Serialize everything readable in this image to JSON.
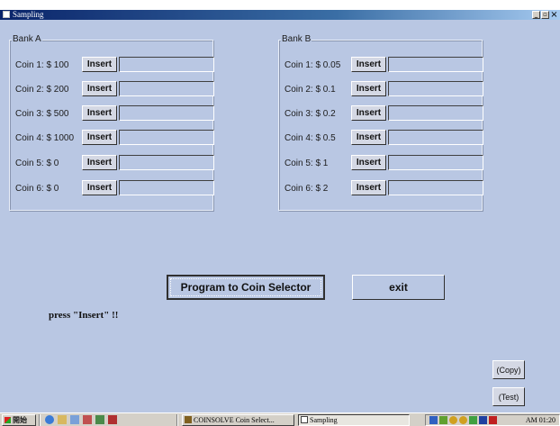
{
  "window": {
    "title": "Sampling",
    "controls": [
      "minimize-icon",
      "maximize-icon",
      "close-icon"
    ],
    "close_glyph": "×"
  },
  "bank_a": {
    "title": "Bank A",
    "coins": [
      {
        "label": "Coin 1: $ 100",
        "button": "Insert"
      },
      {
        "label": "Coin 2: $ 200",
        "button": "Insert"
      },
      {
        "label": "Coin 3: $ 500",
        "button": "Insert"
      },
      {
        "label": "Coin 4: $ 1000",
        "button": "Insert"
      },
      {
        "label": "Coin 5: $ 0",
        "button": "Insert"
      },
      {
        "label": "Coin 6: $ 0",
        "button": "Insert"
      }
    ]
  },
  "bank_b": {
    "title": "Bank B",
    "coins": [
      {
        "label": "Coin 1: $ 0.05",
        "button": "Insert"
      },
      {
        "label": "Coin 2: $ 0.1",
        "button": "Insert"
      },
      {
        "label": "Coin 3: $ 0.2",
        "button": "Insert"
      },
      {
        "label": "Coin 4: $ 0.5",
        "button": "Insert"
      },
      {
        "label": "Coin 5: $ 1",
        "button": "Insert"
      },
      {
        "label": "Coin 6: $ 2",
        "button": "Insert"
      }
    ]
  },
  "actions": {
    "program_label": "Program to Coin Selector",
    "exit_label": "exit",
    "hint": "press  \"Insert\"  !!",
    "copy_label": "(Copy)",
    "test_label": "(Test)"
  },
  "taskbar": {
    "start_label": "開始",
    "tasks": [
      "COINSOLVE  Coin Select...",
      "Sampling"
    ],
    "clock": "AM 01:20"
  },
  "colors": {
    "window_bg": "#b9c7e3",
    "titlebar_start": "#0a246a",
    "titlebar_end": "#a6caf0",
    "taskbar_bg": "#d4d0c8"
  }
}
